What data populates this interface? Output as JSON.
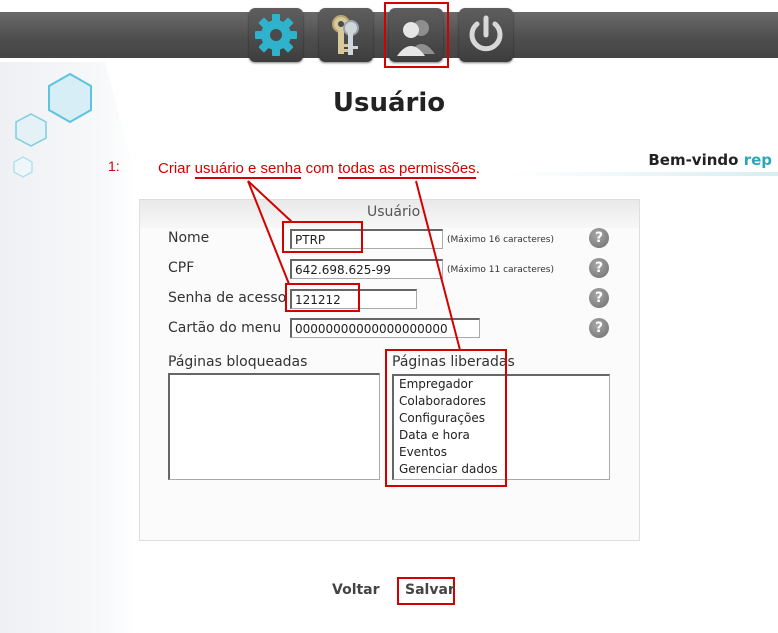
{
  "toolbar": {
    "buttons": [
      {
        "icon": "gear-icon",
        "label": "settings"
      },
      {
        "icon": "keys-icon",
        "label": "keys"
      },
      {
        "icon": "users-icon",
        "label": "users"
      },
      {
        "icon": "power-icon",
        "label": "power"
      }
    ]
  },
  "page": {
    "title": "Usuário",
    "welcome_prefix": "Bem-vindo",
    "welcome_user": "rep"
  },
  "annotation": {
    "number": "1:",
    "parts": [
      "Criar ",
      "usuário e senha",
      " com ",
      "todas as permissões",
      "."
    ]
  },
  "form": {
    "legend": "Usuário",
    "fields": [
      {
        "label": "Nome",
        "value": "PTRP",
        "hint": "(Máximo 16 caracteres)"
      },
      {
        "label": "CPF",
        "value": "642.698.625-99",
        "hint": "(Máximo 11 caracteres)"
      },
      {
        "label": "Senha de acesso",
        "value": "121212",
        "hint": ""
      },
      {
        "label": "Cartão do menu",
        "value": "00000000000000000000",
        "hint": ""
      }
    ],
    "help_symbol": "?",
    "blocked_label": "Páginas bloqueadas",
    "allowed_label": "Páginas liberadas",
    "allowed_pages": [
      "Empregador",
      "Colaboradores",
      "Configurações",
      "Data e hora",
      "Eventos",
      "Gerenciar dados"
    ]
  },
  "footer": {
    "back_label": "Voltar",
    "save_label": "Salvar"
  },
  "colors": {
    "accent": "#2aa8b8",
    "annotation": "#d40000",
    "topbar": "#4d4d4d"
  }
}
